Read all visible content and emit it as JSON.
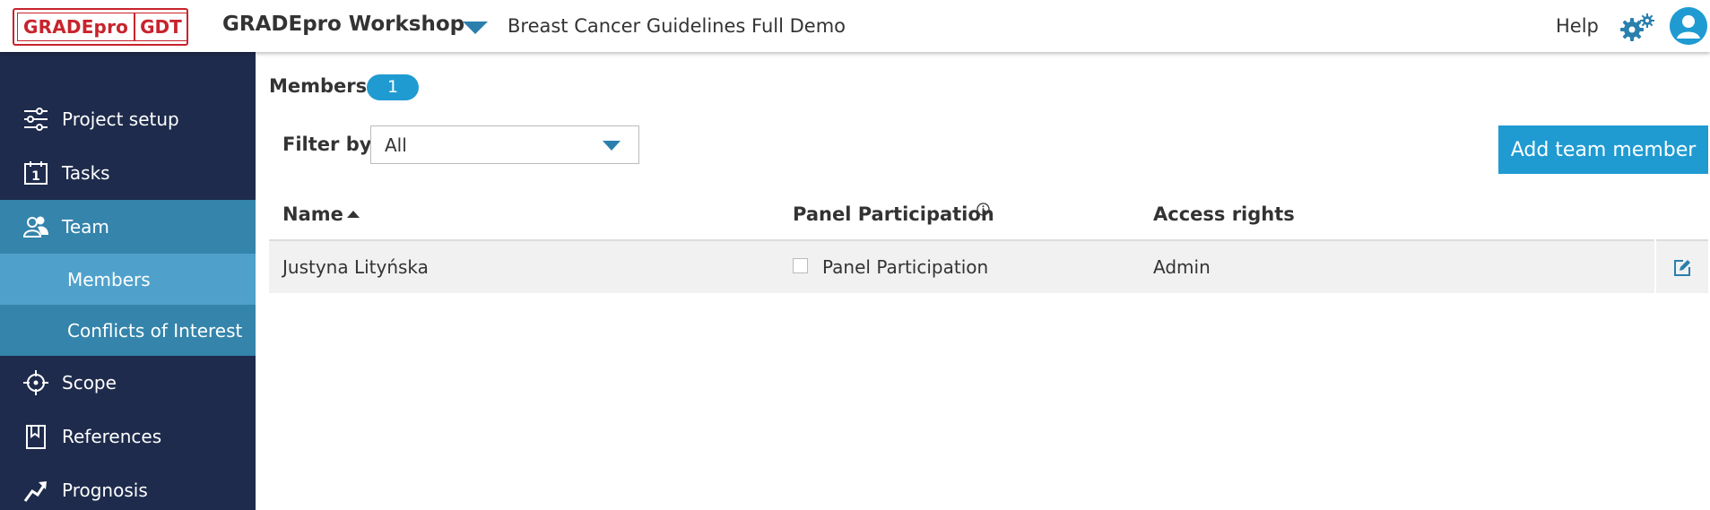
{
  "header": {
    "logo_left": "GRADEpro",
    "logo_right": "GDT",
    "workspace": "GRADEpro Workshop",
    "project": "Breast Cancer Guidelines Full Demo",
    "help": "Help"
  },
  "sidebar": {
    "items": [
      {
        "label": "Project setup",
        "icon": "sliders-icon"
      },
      {
        "label": "Tasks",
        "icon": "calendar-icon"
      },
      {
        "label": "Team",
        "icon": "users-icon"
      },
      {
        "label": "Scope",
        "icon": "crosshair-icon"
      },
      {
        "label": "References",
        "icon": "bookmark-icon"
      },
      {
        "label": "Prognosis",
        "icon": "trend-up-icon"
      }
    ],
    "team_sub": [
      {
        "label": "Members"
      },
      {
        "label": "Conflicts of Interest"
      }
    ]
  },
  "main": {
    "title": "Members",
    "count": "1",
    "filter_label": "Filter by:",
    "filter_value": "All",
    "add_button": "Add team member",
    "columns": {
      "name": "Name",
      "panel": "Panel Participation",
      "access": "Access rights"
    },
    "rows": [
      {
        "name": "Justyna Lityńska",
        "panel": "Panel Participation",
        "panel_checked": false,
        "access": "Admin"
      }
    ]
  },
  "colors": {
    "brand_red": "#c8232c",
    "sidebar_bg": "#1e2b4c",
    "active_blue": "#3484ab",
    "selected_blue": "#4fa1cb",
    "accent_blue": "#1f9bd2"
  }
}
